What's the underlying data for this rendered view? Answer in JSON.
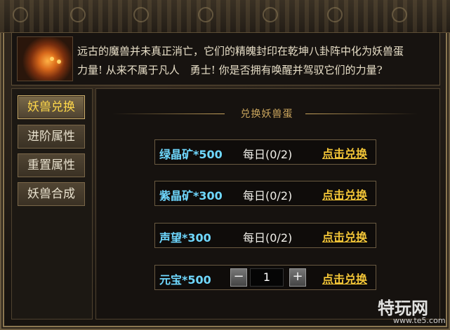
{
  "intro": {
    "line1": "远古的魔兽并未真正消亡，它们的精魄封印在乾坤八卦阵中化为妖兽蛋",
    "line2": "力量! 从来不属于凡人　勇士! 你是否拥有唤醒并驾驭它们的力量?"
  },
  "nav": {
    "items": [
      {
        "label": "妖兽兑换",
        "active": true
      },
      {
        "label": "进阶属性",
        "active": false
      },
      {
        "label": "重置属性",
        "active": false
      },
      {
        "label": "妖兽合成",
        "active": false
      }
    ]
  },
  "section": {
    "title": "兑换妖兽蛋"
  },
  "exchange": {
    "rows": [
      {
        "name": "绿晶矿*500",
        "limit": "每日(0/2)",
        "action": "点击兑换"
      },
      {
        "name": "紫晶矿*300",
        "limit": "每日(0/2)",
        "action": "点击兑换"
      },
      {
        "name": "声望*300",
        "limit": "每日(0/2)",
        "action": "点击兑换"
      },
      {
        "name": "元宝*500",
        "quantity": "1",
        "minus": "−",
        "plus": "+",
        "action": "点击兑换"
      }
    ]
  },
  "watermark": {
    "main": "特玩网",
    "sub": "www.te5.com"
  },
  "colors": {
    "item_name": "#6fd8ff",
    "action": "#f2c537",
    "nav_active_text": "#ffd84a",
    "section_title": "#caa55d"
  }
}
